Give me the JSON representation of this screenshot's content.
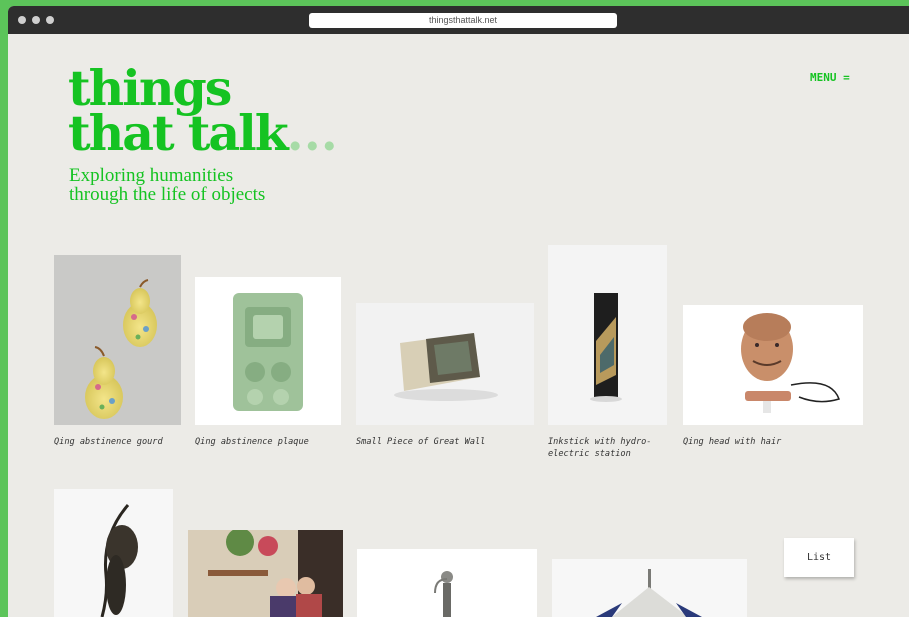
{
  "browser": {
    "url": "thingsthattalk.net"
  },
  "header": {
    "logo_line1": "things",
    "logo_line2": "that talk",
    "logo_dots": "...",
    "tagline_line1": "Exploring humanities",
    "tagline_line2": "through the life of objects",
    "menu_label": "MENU ="
  },
  "objects": [
    {
      "caption": "Qing abstinence gourd"
    },
    {
      "caption": "Qing abstinence plaque"
    },
    {
      "caption": "Small Piece of Great Wall"
    },
    {
      "caption": "Inkstick with hydro-\nelectric station"
    },
    {
      "caption": "Qing head with hair"
    }
  ],
  "list_button": "List",
  "colors": {
    "brand_green": "#15c322",
    "page_bg": "#ecebe7",
    "frame_green": "#5cc45a"
  }
}
